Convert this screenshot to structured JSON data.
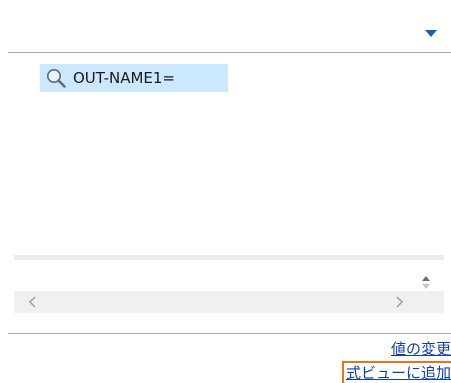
{
  "search_results": {
    "items": [
      {
        "icon": "search-icon",
        "label": "OUT-NAME1=",
        "selected": true
      }
    ]
  },
  "actions": {
    "change_value": "値の変更",
    "add_to_watch": "式ビューに追加"
  },
  "colors": {
    "selection": "#cce8ff",
    "link": "#0f3fa8",
    "focus_outline": "#e8731a",
    "dropdown_arrow": "#1b5fa8"
  }
}
